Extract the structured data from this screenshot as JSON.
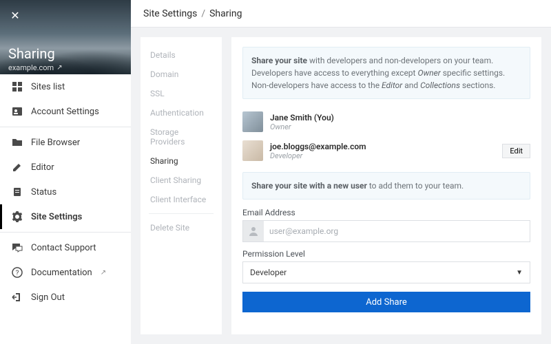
{
  "hero": {
    "title": "Sharing",
    "domain": "example.com"
  },
  "crumbs": {
    "root": "Site Settings",
    "leaf": "Sharing"
  },
  "sidebar": {
    "items": [
      {
        "label": "Sites list"
      },
      {
        "label": "Account Settings"
      },
      {
        "label": "File Browser"
      },
      {
        "label": "Editor"
      },
      {
        "label": "Status"
      },
      {
        "label": "Site Settings"
      },
      {
        "label": "Contact Support"
      },
      {
        "label": "Documentation"
      },
      {
        "label": "Sign Out"
      }
    ]
  },
  "subnav": {
    "items": [
      "Details",
      "Domain",
      "SSL",
      "Authentication",
      "Storage Providers",
      "Sharing",
      "Client Sharing",
      "Client Interface",
      "Delete Site"
    ]
  },
  "panel": {
    "intro": {
      "lead": "Share your site",
      "rest1": " with developers and non-developers on your team. Developers have access to everything except ",
      "owner": "Owner",
      "rest2": " specific settings. Non-developers have access to the ",
      "editor": "Editor",
      "rest3": " and ",
      "collections": "Collections",
      "rest4": " sections."
    },
    "users": [
      {
        "name": "Jane Smith (You)",
        "role": "Owner",
        "editable": false
      },
      {
        "name": "joe.bloggs@example.com",
        "role": "Developer",
        "editable": true
      }
    ],
    "edit_label": "Edit",
    "share_prompt": {
      "lead": "Share your site with a new user",
      "rest": " to add them to your team."
    },
    "email_label": "Email Address",
    "email_placeholder": "user@example.org",
    "perm_label": "Permission Level",
    "perm_value": "Developer",
    "submit": "Add Share"
  }
}
